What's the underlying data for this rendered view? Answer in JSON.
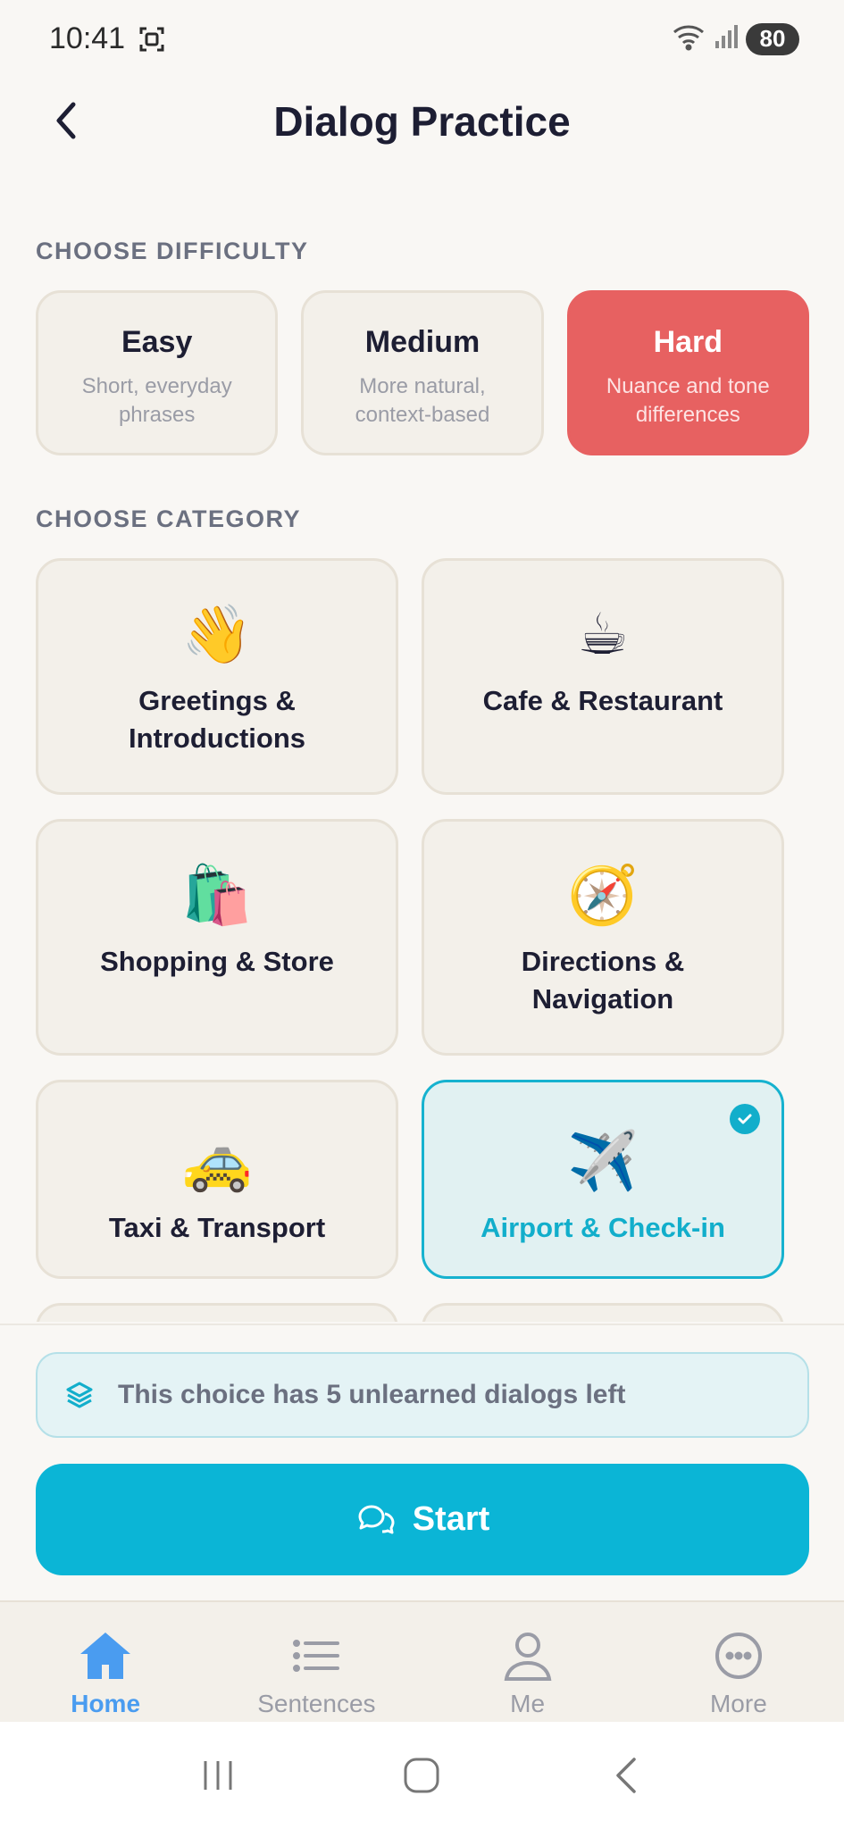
{
  "status_bar": {
    "time": "10:41",
    "battery": "80"
  },
  "header": {
    "title": "Dialog Practice"
  },
  "difficulty": {
    "section_label": "CHOOSE DIFFICULTY",
    "selected": "Hard",
    "options": [
      {
        "title": "Easy",
        "subtitle": "Short, everyday phrases"
      },
      {
        "title": "Medium",
        "subtitle": "More natural, context-based"
      },
      {
        "title": "Hard",
        "subtitle": "Nuance and tone differences"
      }
    ]
  },
  "category": {
    "section_label": "CHOOSE CATEGORY",
    "selected": "Airport & Check-in",
    "items": [
      {
        "label": "Greetings & Introductions",
        "emoji": "👋",
        "icon": "waving-hand-icon"
      },
      {
        "label": "Cafe & Restaurant",
        "emoji": "☕",
        "icon": "coffee-cup-icon"
      },
      {
        "label": "Shopping & Store",
        "emoji": "🛍️",
        "icon": "shopping-bags-icon"
      },
      {
        "label": "Directions & Navigation",
        "emoji": "🧭",
        "icon": "compass-icon"
      },
      {
        "label": "Taxi & Transport",
        "emoji": "🚕",
        "icon": "taxi-icon"
      },
      {
        "label": "Airport & Check-in",
        "emoji": "✈️",
        "icon": "airplane-icon"
      }
    ]
  },
  "info": {
    "text": "This choice has 5 unlearned dialogs left",
    "icon": "layers-icon"
  },
  "start_button": {
    "label": "Start",
    "icon": "chat-bubbles-icon"
  },
  "tabs": [
    {
      "label": "Home",
      "icon": "home-icon",
      "active": true
    },
    {
      "label": "Sentences",
      "icon": "list-icon",
      "active": false
    },
    {
      "label": "Me",
      "icon": "person-icon",
      "active": false
    },
    {
      "label": "More",
      "icon": "more-dots-icon",
      "active": false
    }
  ],
  "colors": {
    "accent": "#0bb5d6",
    "hard_selected": "#e76161",
    "tab_active": "#4a9cf0"
  }
}
